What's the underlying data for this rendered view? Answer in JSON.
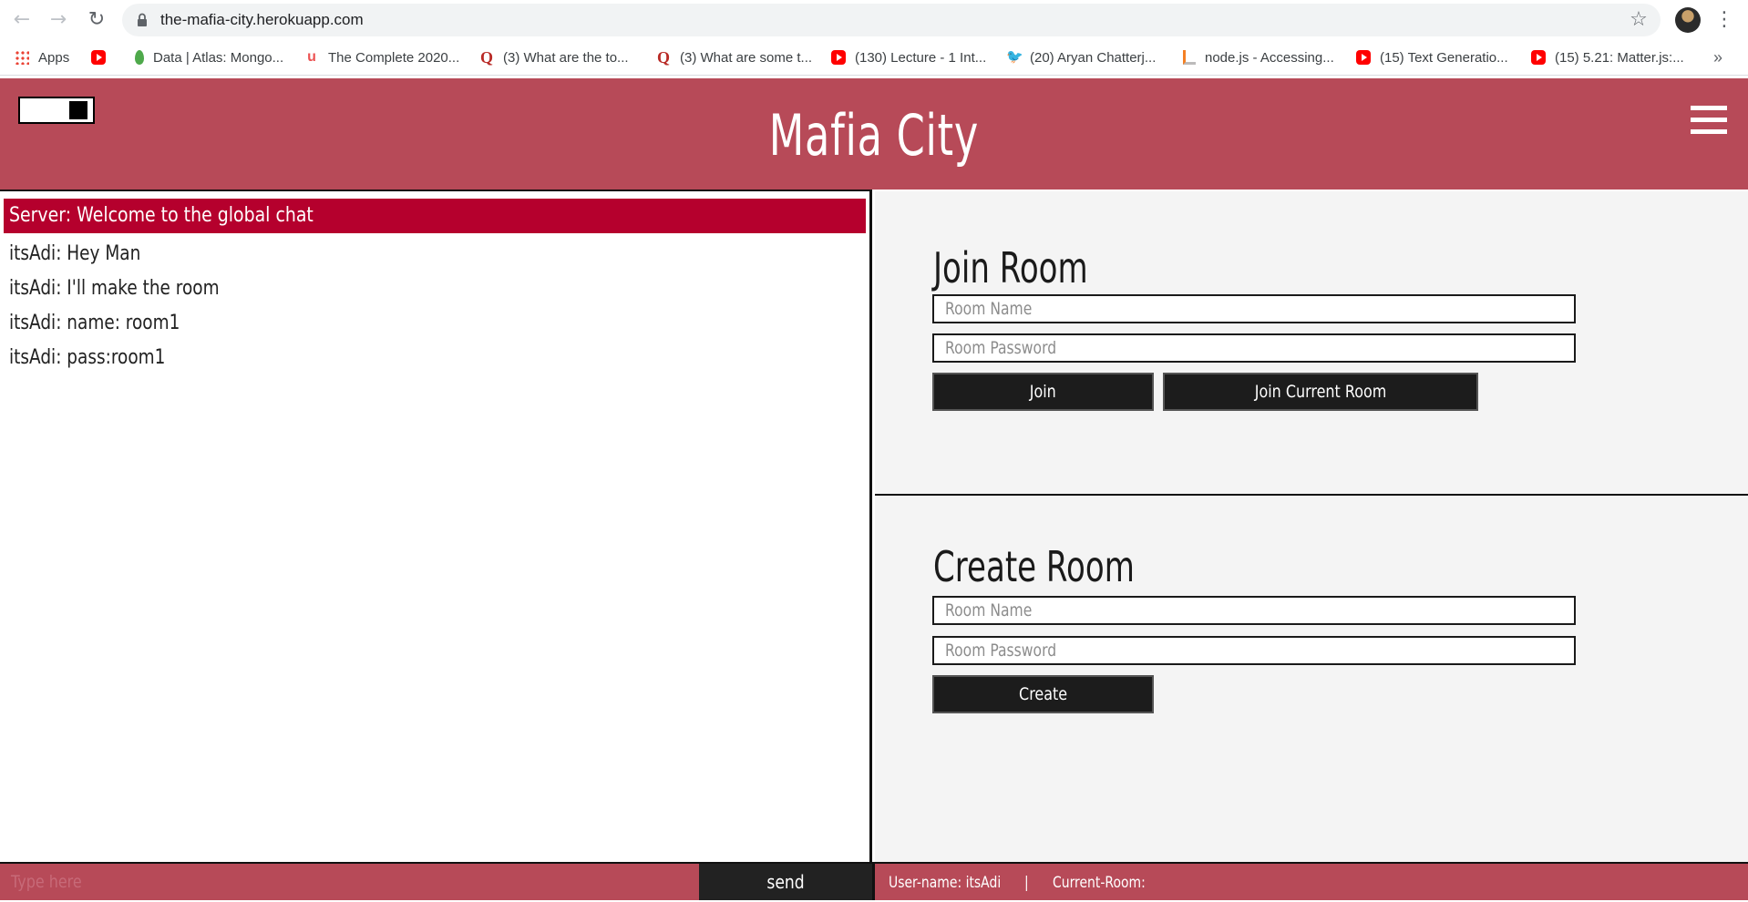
{
  "browser": {
    "url": "the-mafia-city.herokuapp.com",
    "nav": {
      "back_icon": "←",
      "forward_icon": "→",
      "reload_icon": "↻"
    },
    "star_icon": "☆",
    "menu_icon": "⋮",
    "more_icon": "»",
    "bookmarks": [
      {
        "label": "Apps",
        "icon": "apps-grid"
      },
      {
        "label": "",
        "icon": "youtube"
      },
      {
        "label": "Data | Atlas: Mongo...",
        "icon": "mongodb-leaf"
      },
      {
        "label": "The Complete 2020...",
        "icon": "udemy"
      },
      {
        "label": "(3) What are the to...",
        "icon": "quora"
      },
      {
        "label": "(3) What are some t...",
        "icon": "quora"
      },
      {
        "label": "(130) Lecture - 1 Int...",
        "icon": "youtube"
      },
      {
        "label": "(20) Aryan Chatterj...",
        "icon": "twitter"
      },
      {
        "label": "node.js - Accessing...",
        "icon": "stackoverflow"
      },
      {
        "label": "(15) Text Generatio...",
        "icon": "youtube"
      },
      {
        "label": "(15) 5.21: Matter.js:...",
        "icon": "youtube"
      }
    ]
  },
  "header": {
    "title": "Mafia City",
    "accent_color": "#b74a58"
  },
  "chat": {
    "server_message": "Server: Welcome to the global chat",
    "server_color": "#b5002d",
    "messages": [
      "itsAdi: Hey Man",
      "itsAdi: I'll make the room",
      "itsAdi: name: room1",
      "itsAdi: pass:room1"
    ],
    "input_placeholder": "Type here",
    "send_label": "send"
  },
  "join_room": {
    "title": "Join Room",
    "name_placeholder": "Room Name",
    "password_placeholder": "Room Password",
    "join_label": "Join",
    "join_current_label": "Join Current Room"
  },
  "create_room": {
    "title": "Create Room",
    "name_placeholder": "Room Name",
    "password_placeholder": "Room Password",
    "create_label": "Create"
  },
  "status": {
    "username": "User-name: itsAdi",
    "separator": "|",
    "current_room": "Current-Room:"
  }
}
